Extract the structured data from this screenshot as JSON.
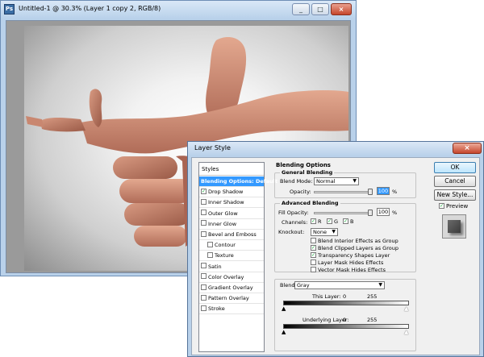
{
  "document_window": {
    "title": "Untitled-1 @ 30.3% (Layer 1 copy 2, RGB/8)",
    "app_icon_label": "Ps",
    "buttons": {
      "minimize": "_",
      "maximize": "□",
      "close": "×"
    }
  },
  "layer_style": {
    "title": "Layer Style",
    "close_label": "×",
    "styles_header": "Styles",
    "styles": [
      {
        "label": "Blending Options: Default",
        "selected": true,
        "checkbox": false,
        "checked": false,
        "indent": false
      },
      {
        "label": "Drop Shadow",
        "selected": false,
        "checkbox": true,
        "checked": true,
        "indent": false
      },
      {
        "label": "Inner Shadow",
        "selected": false,
        "checkbox": true,
        "checked": false,
        "indent": false
      },
      {
        "label": "Outer Glow",
        "selected": false,
        "checkbox": true,
        "checked": false,
        "indent": false
      },
      {
        "label": "Inner Glow",
        "selected": false,
        "checkbox": true,
        "checked": false,
        "indent": false
      },
      {
        "label": "Bevel and Emboss",
        "selected": false,
        "checkbox": true,
        "checked": false,
        "indent": false
      },
      {
        "label": "Contour",
        "selected": false,
        "checkbox": true,
        "checked": false,
        "indent": true
      },
      {
        "label": "Texture",
        "selected": false,
        "checkbox": true,
        "checked": false,
        "indent": true
      },
      {
        "label": "Satin",
        "selected": false,
        "checkbox": true,
        "checked": false,
        "indent": false
      },
      {
        "label": "Color Overlay",
        "selected": false,
        "checkbox": true,
        "checked": false,
        "indent": false
      },
      {
        "label": "Gradient Overlay",
        "selected": false,
        "checkbox": true,
        "checked": false,
        "indent": false
      },
      {
        "label": "Pattern Overlay",
        "selected": false,
        "checkbox": true,
        "checked": false,
        "indent": false
      },
      {
        "label": "Stroke",
        "selected": false,
        "checkbox": true,
        "checked": false,
        "indent": false
      }
    ],
    "blending_options_title": "Blending Options",
    "general_blending": {
      "title": "General Blending",
      "blend_mode_label": "Blend Mode:",
      "blend_mode_value": "Normal",
      "opacity_label": "Opacity:",
      "opacity_value": "100",
      "opacity_unit": "%"
    },
    "advanced_blending": {
      "title": "Advanced Blending",
      "fill_opacity_label": "Fill Opacity:",
      "fill_opacity_value": "100",
      "fill_opacity_unit": "%",
      "channels_label": "Channels:",
      "channels": [
        "R",
        "G",
        "B"
      ],
      "knockout_label": "Knockout:",
      "knockout_value": "None",
      "options": [
        {
          "label": "Blend Interior Effects as Group",
          "checked": false
        },
        {
          "label": "Blend Clipped Layers as Group",
          "checked": true
        },
        {
          "label": "Transparency Shapes Layer",
          "checked": true
        },
        {
          "label": "Layer Mask Hides Effects",
          "checked": false
        },
        {
          "label": "Vector Mask Hides Effects",
          "checked": false
        }
      ]
    },
    "blend_if": {
      "label": "Blend If:",
      "value": "Gray",
      "this_layer_label": "This Layer:",
      "this_layer_min": "0",
      "this_layer_max": "255",
      "underlying_label": "Underlying Layer:",
      "underlying_min": "0",
      "underlying_max": "255"
    },
    "buttons": {
      "ok": "OK",
      "cancel": "Cancel",
      "new_style": "New Style...",
      "preview_label": "Preview",
      "preview_checked": true
    }
  }
}
